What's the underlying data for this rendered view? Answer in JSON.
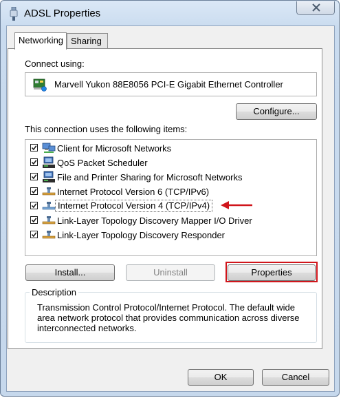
{
  "window": {
    "title": "ADSL Properties",
    "close_label": "✕"
  },
  "tabs": [
    {
      "label": "Networking",
      "active": true
    },
    {
      "label": "Sharing",
      "active": false
    }
  ],
  "connect_using": {
    "label": "Connect using:",
    "adapter": "Marvell Yukon 88E8056 PCI-E Gigabit Ethernet Controller"
  },
  "buttons": {
    "configure": "Configure...",
    "install": "Install...",
    "uninstall": "Uninstall",
    "properties": "Properties",
    "ok": "OK",
    "cancel": "Cancel"
  },
  "items_label": "This connection uses the following items:",
  "items": [
    {
      "label": "Client for Microsoft Networks",
      "checked": true,
      "icon": "network-client-icon"
    },
    {
      "label": "QoS Packet Scheduler",
      "checked": true,
      "icon": "network-service-icon"
    },
    {
      "label": "File and Printer Sharing for Microsoft Networks",
      "checked": true,
      "icon": "network-service-icon"
    },
    {
      "label": "Internet Protocol Version 6 (TCP/IPv6)",
      "checked": true,
      "icon": "protocol-icon"
    },
    {
      "label": "Internet Protocol Version 4 (TCP/IPv4)",
      "checked": true,
      "icon": "protocol-icon",
      "selected": true
    },
    {
      "label": "Link-Layer Topology Discovery Mapper I/O Driver",
      "checked": true,
      "icon": "protocol-icon"
    },
    {
      "label": "Link-Layer Topology Discovery Responder",
      "checked": true,
      "icon": "protocol-icon"
    }
  ],
  "description": {
    "legend": "Description",
    "text": "Transmission Control Protocol/Internet Protocol. The default wide area network protocol that provides communication across diverse interconnected networks."
  },
  "annotations": {
    "highlight_color": "#d0151b"
  }
}
